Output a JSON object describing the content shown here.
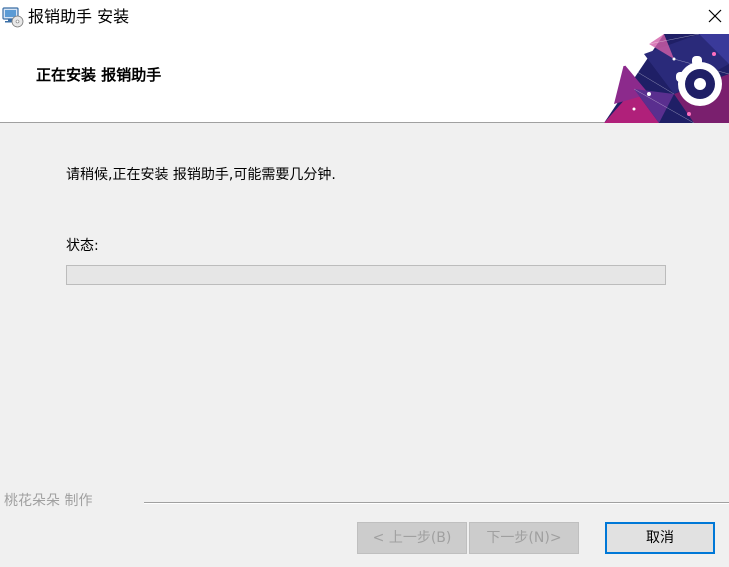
{
  "window": {
    "title": "报销助手 安装",
    "app_icon": "computer-disc-icon",
    "close_icon": "close-icon"
  },
  "banner": {
    "heading": "正在安装 报销助手",
    "graphic": "puzzle-triangle-graphic",
    "colors": {
      "dark": "#1b1b5e",
      "magenta": "#b0207a",
      "purple": "#6a2c8c"
    }
  },
  "main": {
    "message": "请稍候,正在安装 报销助手,可能需要几分钟.",
    "status_label": "状态:",
    "progress_percent": 0
  },
  "footer": {
    "brand": "桃花朵朵  制作",
    "back_button": "< 上一步(B)",
    "next_button": "下一步(N)>",
    "cancel_button": "取消"
  },
  "colors": {
    "accent": "#0078d7",
    "background": "#f0f0f0"
  }
}
